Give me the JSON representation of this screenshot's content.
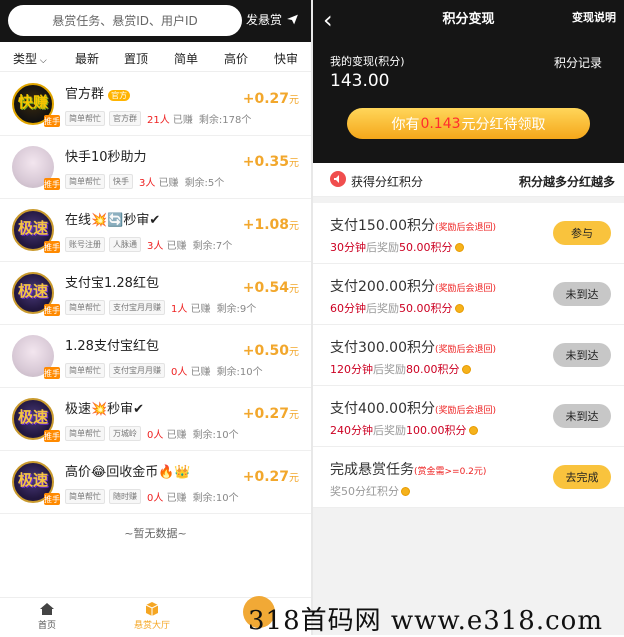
{
  "left": {
    "search_placeholder": "悬赏任务、悬赏ID、用户ID",
    "post_label": "发悬赏",
    "filters": [
      "类型",
      "最新",
      "置顶",
      "简单",
      "高价",
      "快审"
    ],
    "tasks": [
      {
        "title": "官方群",
        "badge": "官方",
        "tags": [
          "简单帮忙",
          "官方群"
        ],
        "done": "21人",
        "done_suffix": "已赚",
        "remain": "剩余:178个",
        "reward": "+0.27",
        "unit": "元",
        "avatar": "logo",
        "avatar_text": "快赚",
        "avatar_badge": "推手"
      },
      {
        "title": "快手10秒助力",
        "tags": [
          "简单帮忙",
          "快手"
        ],
        "done": "3人",
        "done_suffix": "已赚",
        "remain": "剩余:5个",
        "reward": "+0.35",
        "unit": "元",
        "avatar": "light",
        "avatar_badge": "推手"
      },
      {
        "title": "在线💥🔄秒审✔",
        "tags": [
          "账号注册",
          "人脉通"
        ],
        "done": "3人",
        "done_suffix": "已赚",
        "remain": "剩余:7个",
        "reward": "+1.08",
        "unit": "元",
        "avatar": "dark",
        "avatar_text": "极速",
        "avatar_badge": "推手"
      },
      {
        "title": "支付宝1.28红包",
        "tags": [
          "简单帮忙",
          "支付宝月月赚"
        ],
        "done": "1人",
        "done_suffix": "已赚",
        "remain": "剩余:9个",
        "reward": "+0.54",
        "unit": "元",
        "avatar": "dark",
        "avatar_text": "极速",
        "avatar_badge": "推手"
      },
      {
        "title": "1.28支付宝红包",
        "tags": [
          "简单帮忙",
          "支付宝月月赚"
        ],
        "done": "0人",
        "done_suffix": "已赚",
        "remain": "剩余:10个",
        "reward": "+0.50",
        "unit": "元",
        "avatar": "light",
        "avatar_badge": "推手"
      },
      {
        "title": "极速💥秒审✔",
        "tags": [
          "简单帮忙",
          "万城岭"
        ],
        "done": "0人",
        "done_suffix": "已赚",
        "remain": "剩余:10个",
        "reward": "+0.27",
        "unit": "元",
        "avatar": "dark",
        "avatar_text": "极速",
        "avatar_badge": "推手"
      },
      {
        "title": "高价😂回收金币🔥👑",
        "tags": [
          "简单帮忙",
          "随时赚"
        ],
        "done": "0人",
        "done_suffix": "已赚",
        "remain": "剩余:10个",
        "reward": "+0.27",
        "unit": "元",
        "avatar": "dark",
        "avatar_text": "极速",
        "avatar_badge": "推手"
      }
    ],
    "no_more": "~暂无数据~",
    "tabbar": [
      {
        "label": "首页",
        "color": "#555555"
      },
      {
        "label": "悬赏大厅",
        "color": "#f5a623"
      }
    ]
  },
  "right": {
    "back_icon": "chevron-left-icon",
    "title": "积分变现",
    "explain_label": "变现说明",
    "my_label": "我的变现(积分)",
    "my_value": "143.00",
    "record_label": "积分记录",
    "claim_prefix": "你有",
    "claim_amount": "0.143",
    "claim_suffix": "元分红待领取",
    "section_left": "获得分红积分",
    "section_right": "积分越多分红越多",
    "rows": [
      {
        "main": "支付150.00积分",
        "note": "(奖励后会退回)",
        "t": "30分钟",
        "mid": "后奖励",
        "pts": "50.00积分",
        "button": "参与",
        "state": "active"
      },
      {
        "main": "支付200.00积分",
        "note": "(奖励后会退回)",
        "t": "60分钟",
        "mid": "后奖励",
        "pts": "50.00积分",
        "button": "未到达",
        "state": "disabled"
      },
      {
        "main": "支付300.00积分",
        "note": "(奖励后会退回)",
        "t": "120分钟",
        "mid": "后奖励",
        "pts": "80.00积分",
        "button": "未到达",
        "state": "disabled"
      },
      {
        "main": "支付400.00积分",
        "note": "(奖励后会退回)",
        "t": "240分钟",
        "mid": "后奖励",
        "pts": "100.00积分",
        "button": "未到达",
        "state": "disabled"
      },
      {
        "main": "完成悬赏任务",
        "note": "(赏金需>=0.2元)",
        "t": "",
        "mid": "奖50分红积分",
        "pts": "",
        "button": "去完成",
        "state": "active"
      }
    ]
  },
  "watermark": "318首码网 www.e318.com",
  "colors": {
    "accent": "#f2a72c",
    "dark_header": "#151515",
    "red": "#e22222"
  }
}
